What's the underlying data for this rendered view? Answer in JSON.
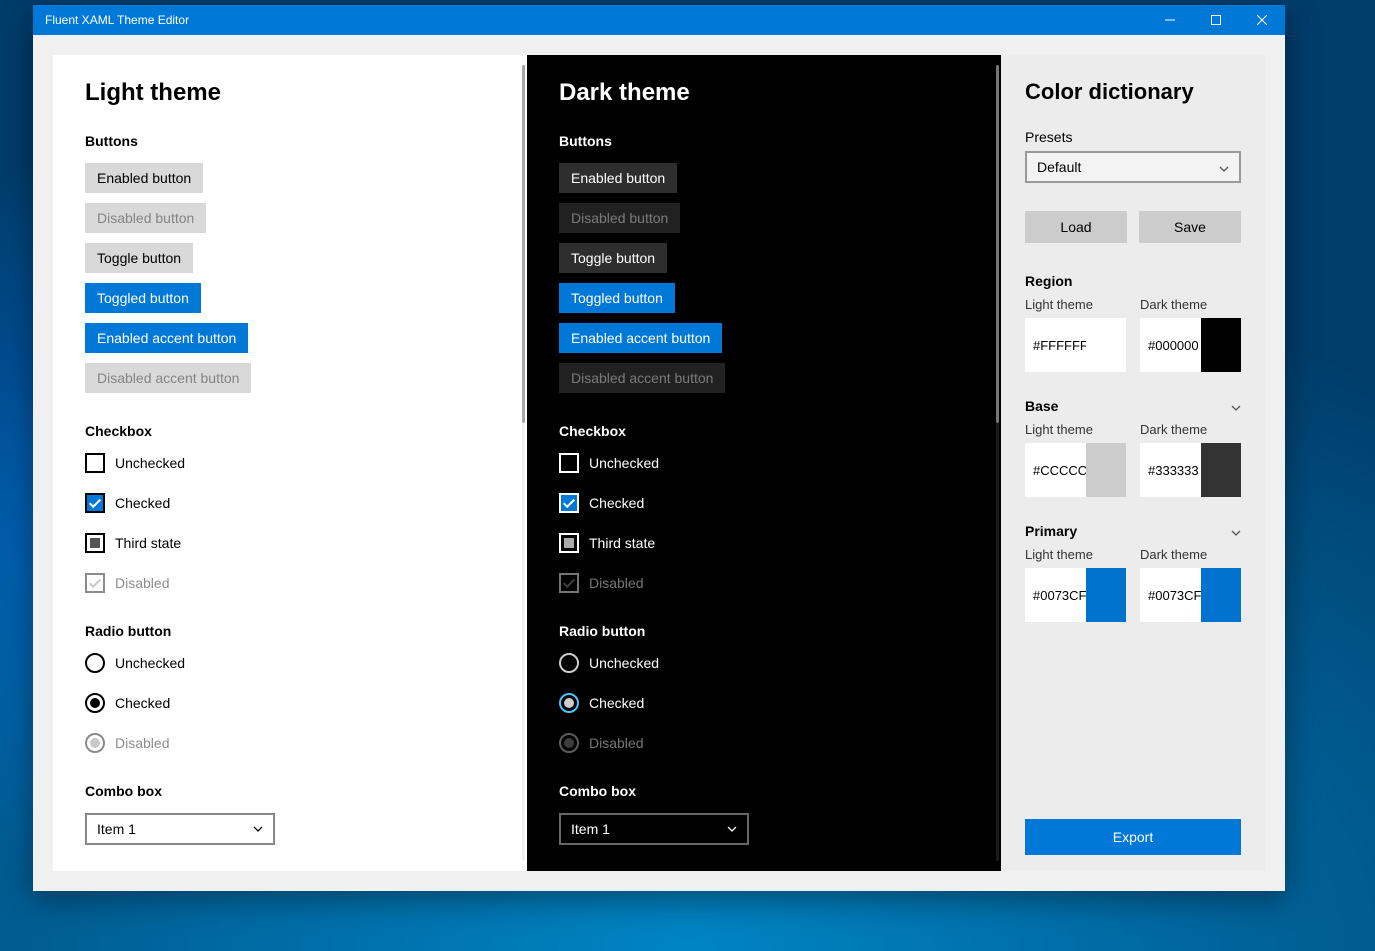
{
  "window": {
    "title": "Fluent XAML Theme Editor"
  },
  "themes": {
    "light": {
      "title": "Light theme"
    },
    "dark": {
      "title": "Dark theme"
    }
  },
  "sections": {
    "buttons": "Buttons",
    "checkbox": "Checkbox",
    "radio": "Radio button",
    "combo": "Combo box"
  },
  "buttons": {
    "enabled": "Enabled button",
    "disabled": "Disabled button",
    "toggle": "Toggle button",
    "toggled": "Toggled button",
    "accent_enabled": "Enabled accent button",
    "accent_disabled": "Disabled accent button"
  },
  "checkbox": {
    "unchecked": "Unchecked",
    "checked": "Checked",
    "third": "Third state",
    "disabled": "Disabled"
  },
  "radio": {
    "unchecked": "Unchecked",
    "checked": "Checked",
    "disabled": "Disabled"
  },
  "combo": {
    "item": "Item 1"
  },
  "side": {
    "title": "Color dictionary",
    "presets_label": "Presets",
    "preset_value": "Default",
    "load": "Load",
    "save": "Save",
    "export": "Export",
    "light_theme_label": "Light theme",
    "dark_theme_label": "Dark theme",
    "groups": {
      "region": {
        "label": "Region",
        "light": {
          "hex": "#FFFFFF",
          "color": "#FFFFFF"
        },
        "dark": {
          "hex": "#000000",
          "color": "#000000"
        }
      },
      "base": {
        "label": "Base",
        "light": {
          "hex": "#CCCCCC",
          "color": "#CCCCCC"
        },
        "dark": {
          "hex": "#333333",
          "color": "#333333"
        }
      },
      "primary": {
        "label": "Primary",
        "light": {
          "hex": "#0073CF",
          "color": "#0073CF"
        },
        "dark": {
          "hex": "#0073CF",
          "color": "#0073CF"
        }
      }
    }
  }
}
